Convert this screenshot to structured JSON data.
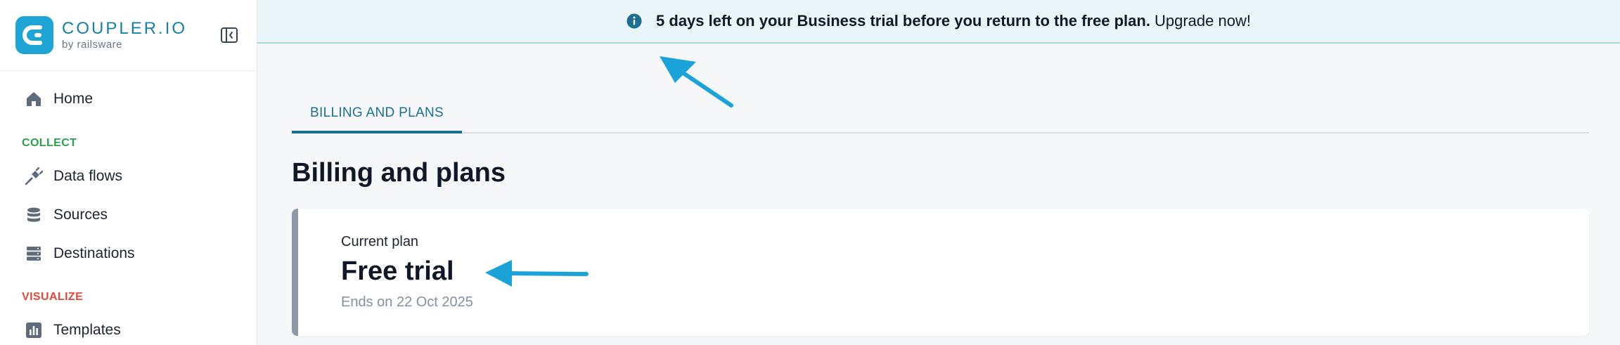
{
  "brand": {
    "name": "COUPLER.IO",
    "sub": "by railsware",
    "color": "#1ea5d6"
  },
  "sidebar": {
    "home": {
      "label": "Home",
      "icon": "home-icon"
    },
    "sections": {
      "collect": {
        "label": "COLLECT",
        "color": "#2aa14a"
      },
      "visualize": {
        "label": "VISUALIZE",
        "color": "#e5483c"
      }
    },
    "items": [
      {
        "label": "Data flows",
        "icon": "plug-icon"
      },
      {
        "label": "Sources",
        "icon": "database-icon"
      },
      {
        "label": "Destinations",
        "icon": "server-icon"
      },
      {
        "label": "Templates",
        "icon": "bar-chart-icon"
      }
    ]
  },
  "banner": {
    "bold": "5 days left on your Business trial before you return to the free plan.",
    "link": "Upgrade now!",
    "icon": "info-icon"
  },
  "tabs": [
    {
      "label": "BILLING AND PLANS",
      "active": true
    }
  ],
  "page": {
    "title": "Billing and plans"
  },
  "plan": {
    "label": "Current plan",
    "name": "Free trial",
    "ends": "Ends on 22 Oct 2025"
  },
  "colors": {
    "accent": "#1a6f93",
    "arrow": "#1aa3d8"
  }
}
